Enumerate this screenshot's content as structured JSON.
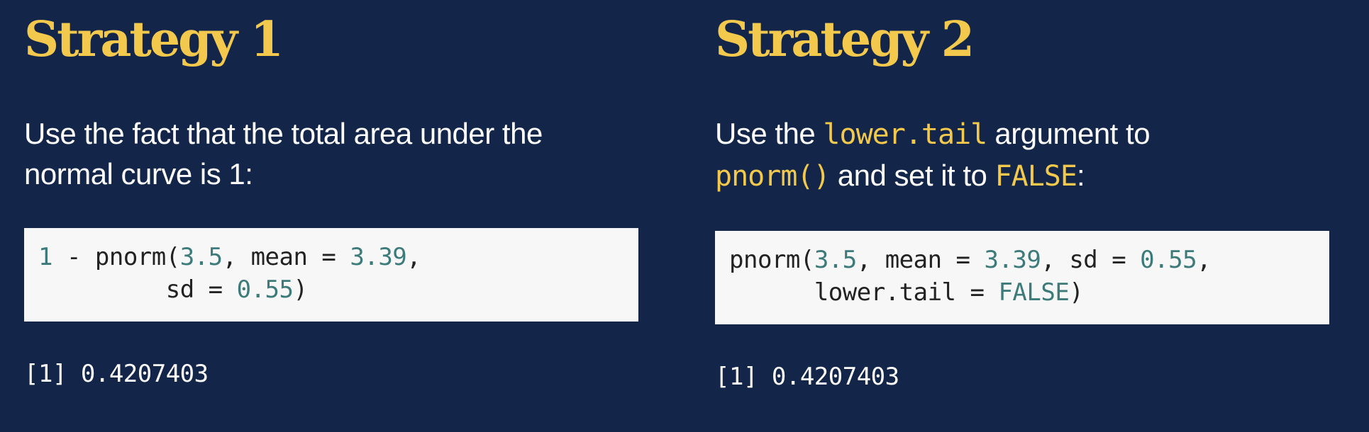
{
  "colors": {
    "background": "#13264a",
    "heading": "#f2c94c",
    "text": "#ffffff",
    "inline_code": "#f2c94c",
    "code_background": "#f7f7f7",
    "code_text": "#222222",
    "code_number": "#3d7a7a"
  },
  "strategy1": {
    "title": "Strategy 1",
    "text_line1": "Use the fact that the total area under the",
    "text_line2": "normal curve is 1:",
    "code": {
      "line1": {
        "n1": "1",
        "t1": " - pnorm(",
        "n2": "3.5",
        "t2": ", mean = ",
        "n3": "3.39",
        "t3": ","
      },
      "line2": {
        "t1": "         sd = ",
        "n1": "0.55",
        "t2": ")"
      }
    },
    "output": "[1] 0.4207403"
  },
  "strategy2": {
    "title": "Strategy 2",
    "text": {
      "p1": "Use the ",
      "c1": "lower.tail",
      "p2": " argument to",
      "c2": "pnorm()",
      "p3": " and set it to ",
      "c3": "FALSE",
      "p4": ":"
    },
    "code": {
      "line1": {
        "t1": "pnorm(",
        "n1": "3.5",
        "t2": ", mean = ",
        "n2": "3.39",
        "t3": ", sd = ",
        "n3": "0.55",
        "t4": ","
      },
      "line2": {
        "t1": "      lower.tail = ",
        "n1": "FALSE",
        "t2": ")"
      }
    },
    "output": "[1] 0.4207403"
  }
}
